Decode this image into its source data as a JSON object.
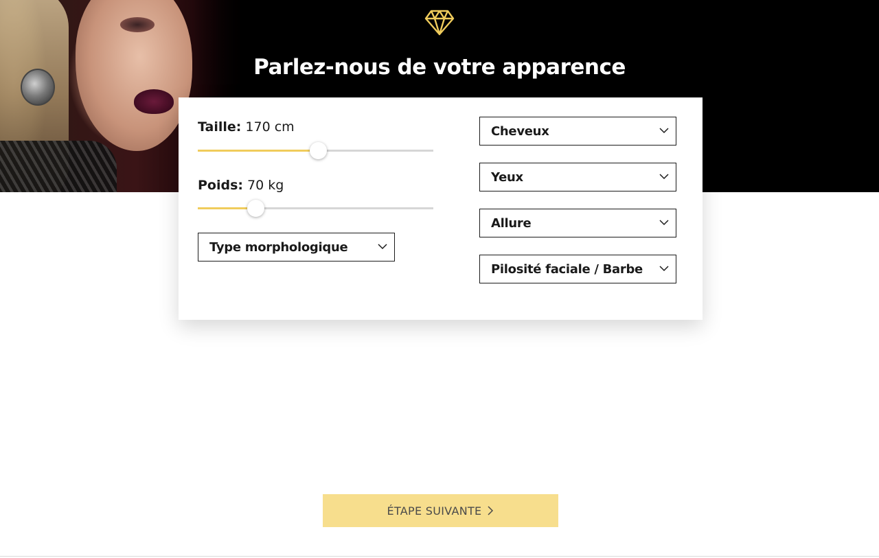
{
  "header": {
    "title": "Parlez-nous de votre apparence",
    "icon": "diamond-icon"
  },
  "form": {
    "height": {
      "label": "Taille:",
      "value": "170 cm",
      "level": 0.51
    },
    "weight": {
      "label": "Poids:",
      "value": "70 kg",
      "level": 0.245
    },
    "body_type": {
      "label": "Type morphologique"
    },
    "hair": {
      "label": "Cheveux"
    },
    "eyes": {
      "label": "Yeux"
    },
    "style": {
      "label": "Allure"
    },
    "facial_hair": {
      "label": "Pilosité faciale / Barbe"
    }
  },
  "actions": {
    "next_label": "ÉTAPE SUIVANTE"
  },
  "colors": {
    "accent": "#f0cc5c",
    "button": "#f7de8d",
    "hero_bg": "#000000"
  }
}
